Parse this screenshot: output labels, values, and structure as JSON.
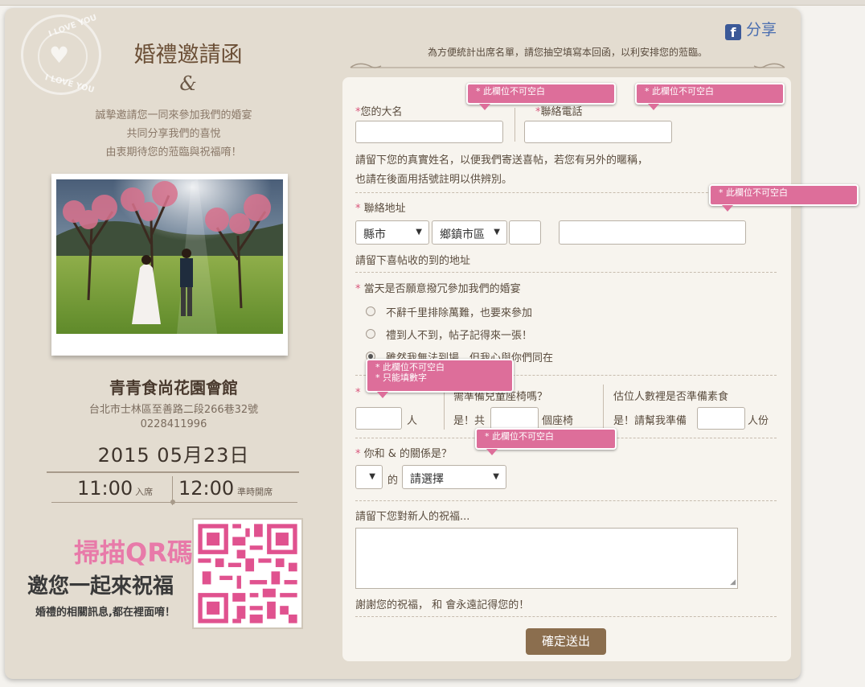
{
  "left": {
    "stamp_text_top": "I LOVE YOU",
    "stamp_text_bottom": "I LOVE YOU",
    "title": "婚禮邀請函",
    "ampersand": "&",
    "invitation_lines": [
      "誠摯邀請您一同來參加我們的婚宴",
      "共同分享我們的喜悅",
      "由衷期待您的蒞臨與祝福唷！"
    ],
    "venue": "青青食尚花園會館",
    "address": "台北市士林區至善路二段266巷32號",
    "phone": "0228411996",
    "date": "2015 05月23日",
    "time_in": "11:00",
    "time_in_label": "入席",
    "time_start": "12:00",
    "time_start_label": "準時開席",
    "qr_line1": "掃描QR碼",
    "qr_line2": "邀您一起來祝福",
    "qr_line3": "婚禮的相關訊息,都在裡面唷！"
  },
  "header": {
    "share_label": "分享",
    "fb_glyph": "f",
    "note": "為方便統計出席名單，請您抽空填寫本回函，以利安排您的蒞臨。"
  },
  "form": {
    "name_label": "您的大名",
    "phone_label": "聯絡電話",
    "name_hint_1": "請留下您的真實姓名，以便我們寄送喜帖，若您有另外的暱稱，",
    "name_hint_2": "也請在後面用括號註明以供辨別。",
    "address_label": "聯絡地址",
    "county_select": "縣市",
    "district_select": "鄉鎮市區",
    "address_hint": "請留下喜帖收的到的地址",
    "attend_label": "當天是否願意撥冗參加我們的婚宴",
    "attend_options": [
      "不辭千里排除萬難，也要來參加",
      "禮到人不到，帖子記得來一張！",
      "雖然我無法到場，但我心與你們同在"
    ],
    "people_unit": "人",
    "child_seat_label": "需準備兒童座椅嗎？",
    "child_seat_prefix": "是！共",
    "child_seat_unit": "個座椅",
    "veg_label": "估位人數裡是否準備素食",
    "veg_prefix": "是！請幫我準備",
    "veg_unit": "人份",
    "relation_label": "你和 & 的關係是？",
    "relation_of": "的",
    "relation_select": "請選擇",
    "wish_label": "請留下您對新人的祝福...",
    "wish_thanks": "謝謝您的祝福， 和 會永遠記得您的！",
    "submit_label": "確定送出",
    "error_required": "* 此欄位不可空白",
    "error_numeric": "* 只能填數字",
    "select_arrow": "▼",
    "resize_grip": "◢"
  }
}
